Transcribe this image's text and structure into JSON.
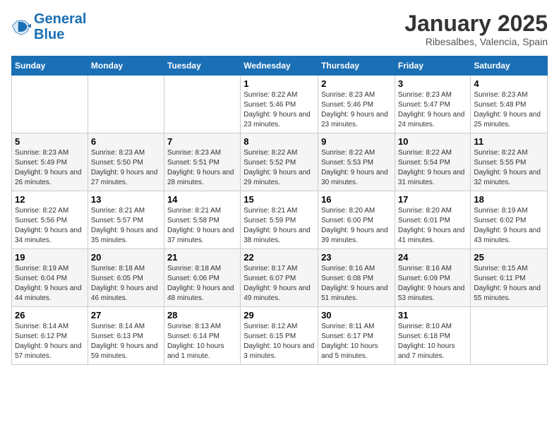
{
  "header": {
    "logo_line1": "General",
    "logo_line2": "Blue",
    "month": "January 2025",
    "location": "Ribesalbes, Valencia, Spain"
  },
  "days_of_week": [
    "Sunday",
    "Monday",
    "Tuesday",
    "Wednesday",
    "Thursday",
    "Friday",
    "Saturday"
  ],
  "weeks": [
    [
      {
        "day": "",
        "info": ""
      },
      {
        "day": "",
        "info": ""
      },
      {
        "day": "",
        "info": ""
      },
      {
        "day": "1",
        "info": "Sunrise: 8:22 AM\nSunset: 5:46 PM\nDaylight: 9 hours and 23 minutes."
      },
      {
        "day": "2",
        "info": "Sunrise: 8:23 AM\nSunset: 5:46 PM\nDaylight: 9 hours and 23 minutes."
      },
      {
        "day": "3",
        "info": "Sunrise: 8:23 AM\nSunset: 5:47 PM\nDaylight: 9 hours and 24 minutes."
      },
      {
        "day": "4",
        "info": "Sunrise: 8:23 AM\nSunset: 5:48 PM\nDaylight: 9 hours and 25 minutes."
      }
    ],
    [
      {
        "day": "5",
        "info": "Sunrise: 8:23 AM\nSunset: 5:49 PM\nDaylight: 9 hours and 26 minutes."
      },
      {
        "day": "6",
        "info": "Sunrise: 8:23 AM\nSunset: 5:50 PM\nDaylight: 9 hours and 27 minutes."
      },
      {
        "day": "7",
        "info": "Sunrise: 8:23 AM\nSunset: 5:51 PM\nDaylight: 9 hours and 28 minutes."
      },
      {
        "day": "8",
        "info": "Sunrise: 8:22 AM\nSunset: 5:52 PM\nDaylight: 9 hours and 29 minutes."
      },
      {
        "day": "9",
        "info": "Sunrise: 8:22 AM\nSunset: 5:53 PM\nDaylight: 9 hours and 30 minutes."
      },
      {
        "day": "10",
        "info": "Sunrise: 8:22 AM\nSunset: 5:54 PM\nDaylight: 9 hours and 31 minutes."
      },
      {
        "day": "11",
        "info": "Sunrise: 8:22 AM\nSunset: 5:55 PM\nDaylight: 9 hours and 32 minutes."
      }
    ],
    [
      {
        "day": "12",
        "info": "Sunrise: 8:22 AM\nSunset: 5:56 PM\nDaylight: 9 hours and 34 minutes."
      },
      {
        "day": "13",
        "info": "Sunrise: 8:21 AM\nSunset: 5:57 PM\nDaylight: 9 hours and 35 minutes."
      },
      {
        "day": "14",
        "info": "Sunrise: 8:21 AM\nSunset: 5:58 PM\nDaylight: 9 hours and 37 minutes."
      },
      {
        "day": "15",
        "info": "Sunrise: 8:21 AM\nSunset: 5:59 PM\nDaylight: 9 hours and 38 minutes."
      },
      {
        "day": "16",
        "info": "Sunrise: 8:20 AM\nSunset: 6:00 PM\nDaylight: 9 hours and 39 minutes."
      },
      {
        "day": "17",
        "info": "Sunrise: 8:20 AM\nSunset: 6:01 PM\nDaylight: 9 hours and 41 minutes."
      },
      {
        "day": "18",
        "info": "Sunrise: 8:19 AM\nSunset: 6:02 PM\nDaylight: 9 hours and 43 minutes."
      }
    ],
    [
      {
        "day": "19",
        "info": "Sunrise: 8:19 AM\nSunset: 6:04 PM\nDaylight: 9 hours and 44 minutes."
      },
      {
        "day": "20",
        "info": "Sunrise: 8:18 AM\nSunset: 6:05 PM\nDaylight: 9 hours and 46 minutes."
      },
      {
        "day": "21",
        "info": "Sunrise: 8:18 AM\nSunset: 6:06 PM\nDaylight: 9 hours and 48 minutes."
      },
      {
        "day": "22",
        "info": "Sunrise: 8:17 AM\nSunset: 6:07 PM\nDaylight: 9 hours and 49 minutes."
      },
      {
        "day": "23",
        "info": "Sunrise: 8:16 AM\nSunset: 6:08 PM\nDaylight: 9 hours and 51 minutes."
      },
      {
        "day": "24",
        "info": "Sunrise: 8:16 AM\nSunset: 6:09 PM\nDaylight: 9 hours and 53 minutes."
      },
      {
        "day": "25",
        "info": "Sunrise: 8:15 AM\nSunset: 6:11 PM\nDaylight: 9 hours and 55 minutes."
      }
    ],
    [
      {
        "day": "26",
        "info": "Sunrise: 8:14 AM\nSunset: 6:12 PM\nDaylight: 9 hours and 57 minutes."
      },
      {
        "day": "27",
        "info": "Sunrise: 8:14 AM\nSunset: 6:13 PM\nDaylight: 9 hours and 59 minutes."
      },
      {
        "day": "28",
        "info": "Sunrise: 8:13 AM\nSunset: 6:14 PM\nDaylight: 10 hours and 1 minute."
      },
      {
        "day": "29",
        "info": "Sunrise: 8:12 AM\nSunset: 6:15 PM\nDaylight: 10 hours and 3 minutes."
      },
      {
        "day": "30",
        "info": "Sunrise: 8:11 AM\nSunset: 6:17 PM\nDaylight: 10 hours and 5 minutes."
      },
      {
        "day": "31",
        "info": "Sunrise: 8:10 AM\nSunset: 6:18 PM\nDaylight: 10 hours and 7 minutes."
      },
      {
        "day": "",
        "info": ""
      }
    ]
  ]
}
